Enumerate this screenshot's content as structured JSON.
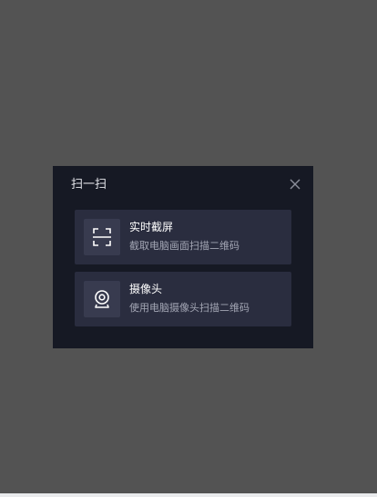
{
  "dialog": {
    "title": "扫一扫",
    "close_icon": "close-icon"
  },
  "options": [
    {
      "title": "实时截屏",
      "description": "截取电脑画面扫描二维码",
      "icon": "screenshot-frame-icon"
    },
    {
      "title": "摄像头",
      "description": "使用电脑摄像头扫描二维码",
      "icon": "webcam-icon"
    }
  ],
  "colors": {
    "backdrop": "#535353",
    "dialog_bg": "#161924",
    "option_bg": "#2a2d3f",
    "icon_bg": "#383b4f",
    "title_text": "#ffffff",
    "desc_text": "#a3a6b4"
  }
}
